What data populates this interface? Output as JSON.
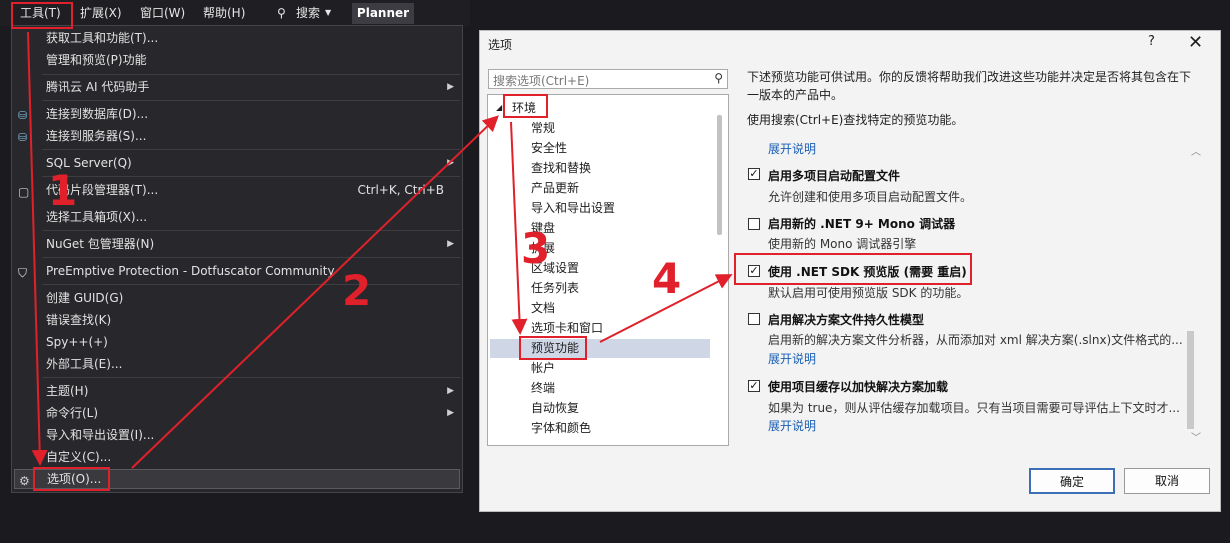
{
  "menubar": {
    "tools": "工具(T)",
    "extensions": "扩展(X)",
    "window": "窗口(W)",
    "help": "帮助(H)",
    "search": "搜索",
    "planner": "Planner"
  },
  "dropdown": {
    "items": [
      {
        "label": "获取工具和功能(T)..."
      },
      {
        "label": "管理和预览(P)功能"
      },
      {
        "label": "腾讯云 AI 代码助手"
      },
      {
        "label": "连接到数据库(D)..."
      },
      {
        "label": "连接到服务器(S)..."
      },
      {
        "label": "SQL Server(Q)"
      },
      {
        "label": "代码片段管理器(T)...",
        "shortcut": "Ctrl+K, Ctrl+B"
      },
      {
        "label": "选择工具箱项(X)..."
      },
      {
        "label": "NuGet 包管理器(N)"
      },
      {
        "label": "PreEmptive Protection - Dotfuscator Community"
      },
      {
        "label": "创建 GUID(G)"
      },
      {
        "label": "错误查找(K)"
      },
      {
        "label": "Spy++(+)"
      },
      {
        "label": "外部工具(E)..."
      },
      {
        "label": "主题(H)"
      },
      {
        "label": "命令行(L)"
      },
      {
        "label": "导入和导出设置(I)..."
      },
      {
        "label": "自定义(C)..."
      },
      {
        "label": "选项(O)..."
      }
    ]
  },
  "dialog": {
    "title": "选项",
    "help": "?",
    "close": "✕",
    "search_placeholder": "搜索选项(Ctrl+E)",
    "tree": {
      "root": "环境",
      "items": [
        "常规",
        "安全性",
        "查找和替换",
        "产品更新",
        "导入和导出设置",
        "键盘",
        "扩展",
        "区域设置",
        "任务列表",
        "文档",
        "选项卡和窗口",
        "预览功能",
        "帐户",
        "终端",
        "自动恢复",
        "字体和颜色"
      ]
    },
    "intro_line1": "下述预览功能可供试用。你的反馈将帮助我们改进这些功能并决定是否将其包含在下",
    "intro_line2": "一版本的产品中。",
    "search_hint": "使用搜索(Ctrl+E)查找特定的预览功能。",
    "collapse_link": "展开说明",
    "options": [
      {
        "title": "启用多项目启动配置文件",
        "desc": "允许创建和使用多项目启动配置文件。",
        "checked": true
      },
      {
        "title": "启用新的 .NET 9+ Mono 调试器",
        "desc": "使用新的 Mono 调试器引擎",
        "checked": false
      },
      {
        "title": "使用 .NET SDK 预览版 (需要 重启)",
        "desc": "默认启用可使用预览版 SDK 的功能。",
        "checked": true
      },
      {
        "title": "启用解决方案文件持久性模型",
        "desc": "启用新的解决方案文件分析器，从而添加对 xml 解决方案(.slnx)文件格式的...",
        "link": "展开说明",
        "checked": false
      },
      {
        "title": "使用项目缓存以加快解决方案加载",
        "desc": "如果为 true，则从评估缓存加载项目。只有当项目需要可导评估上下文时才...",
        "link": "展开说明",
        "checked": true
      }
    ],
    "ok": "确定",
    "cancel": "取消"
  },
  "annotations": {
    "n1": "1",
    "n2": "2",
    "n3": "3",
    "n4": "4",
    "color": "#e0202a"
  }
}
